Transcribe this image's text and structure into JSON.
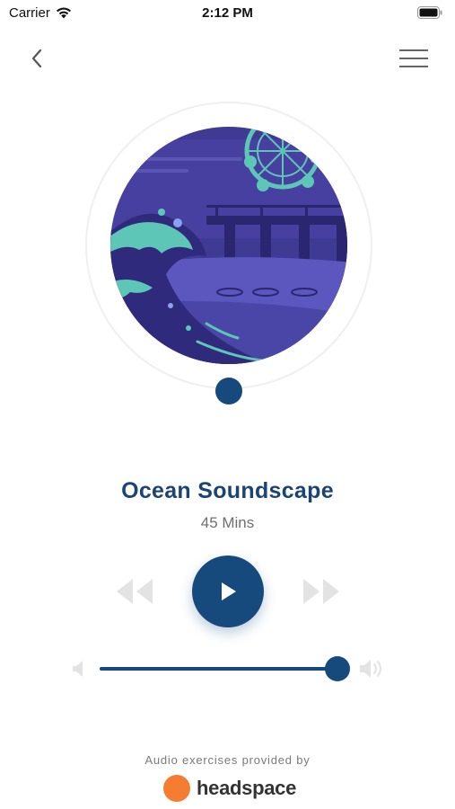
{
  "status_bar": {
    "carrier": "Carrier",
    "time": "2:12 PM"
  },
  "nav": {
    "back_icon": "chevron-left-icon",
    "menu_icon": "hamburger-menu-icon"
  },
  "player": {
    "title": "Ocean Soundscape",
    "duration": "45 Mins",
    "playback_progress": 0.5,
    "volume": 1.0
  },
  "footer": {
    "provided_by": "Audio exercises provided by",
    "brand": "headspace"
  },
  "colors": {
    "primary": "#174a7c",
    "title": "#1b4475",
    "brand_orange": "#f47d31",
    "inactive": "#e3e3e3"
  }
}
